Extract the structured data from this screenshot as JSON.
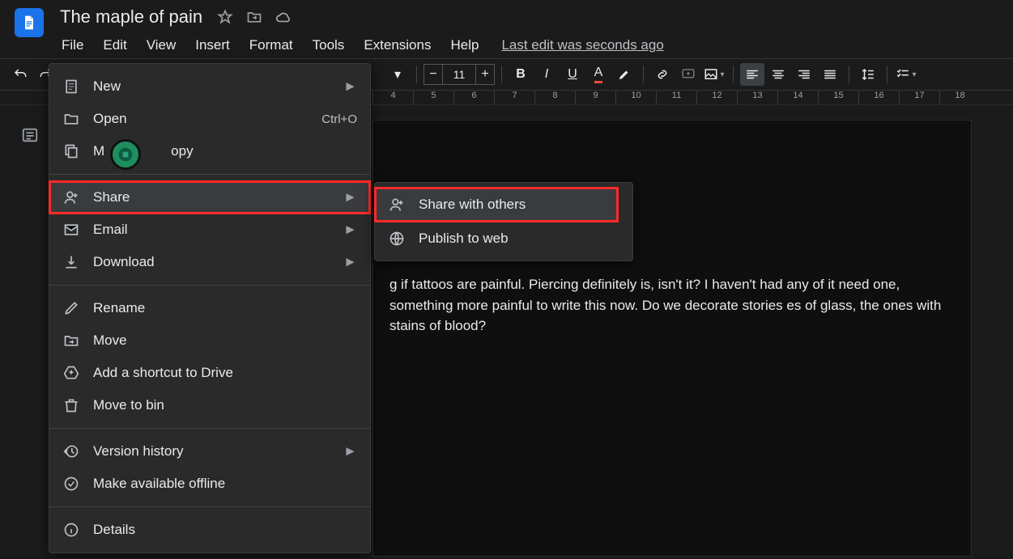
{
  "doc_title": "The maple of pain",
  "menubar": {
    "file": "File",
    "edit": "Edit",
    "view": "View",
    "insert": "Insert",
    "format": "Format",
    "tools": "Tools",
    "extensions": "Extensions",
    "help": "Help",
    "last_edit": "Last edit was seconds ago"
  },
  "toolbar": {
    "font_size": "11"
  },
  "ruler": [
    "4",
    "5",
    "6",
    "7",
    "8",
    "9",
    "10",
    "11",
    "12",
    "13",
    "14",
    "15",
    "16",
    "17",
    "18"
  ],
  "file_menu": {
    "new": "New",
    "open": "Open",
    "open_shortcut": "Ctrl+O",
    "make_a_copy_prefix": "M",
    "make_a_copy_suffix": "opy",
    "share": "Share",
    "email": "Email",
    "download": "Download",
    "rename": "Rename",
    "move": "Move",
    "add_shortcut": "Add a shortcut to Drive",
    "move_to_bin": "Move to bin",
    "version_history": "Version history",
    "make_available_offline": "Make available offline",
    "details": "Details"
  },
  "share_submenu": {
    "share_with_others": "Share with others",
    "publish_to_web": "Publish to web"
  },
  "document_text": "g if tattoos are painful. Piercing definitely is, isn't it? I haven't had any of it  need one, something more painful to write this now. Do we decorate stories es of glass, the ones with stains of blood?"
}
